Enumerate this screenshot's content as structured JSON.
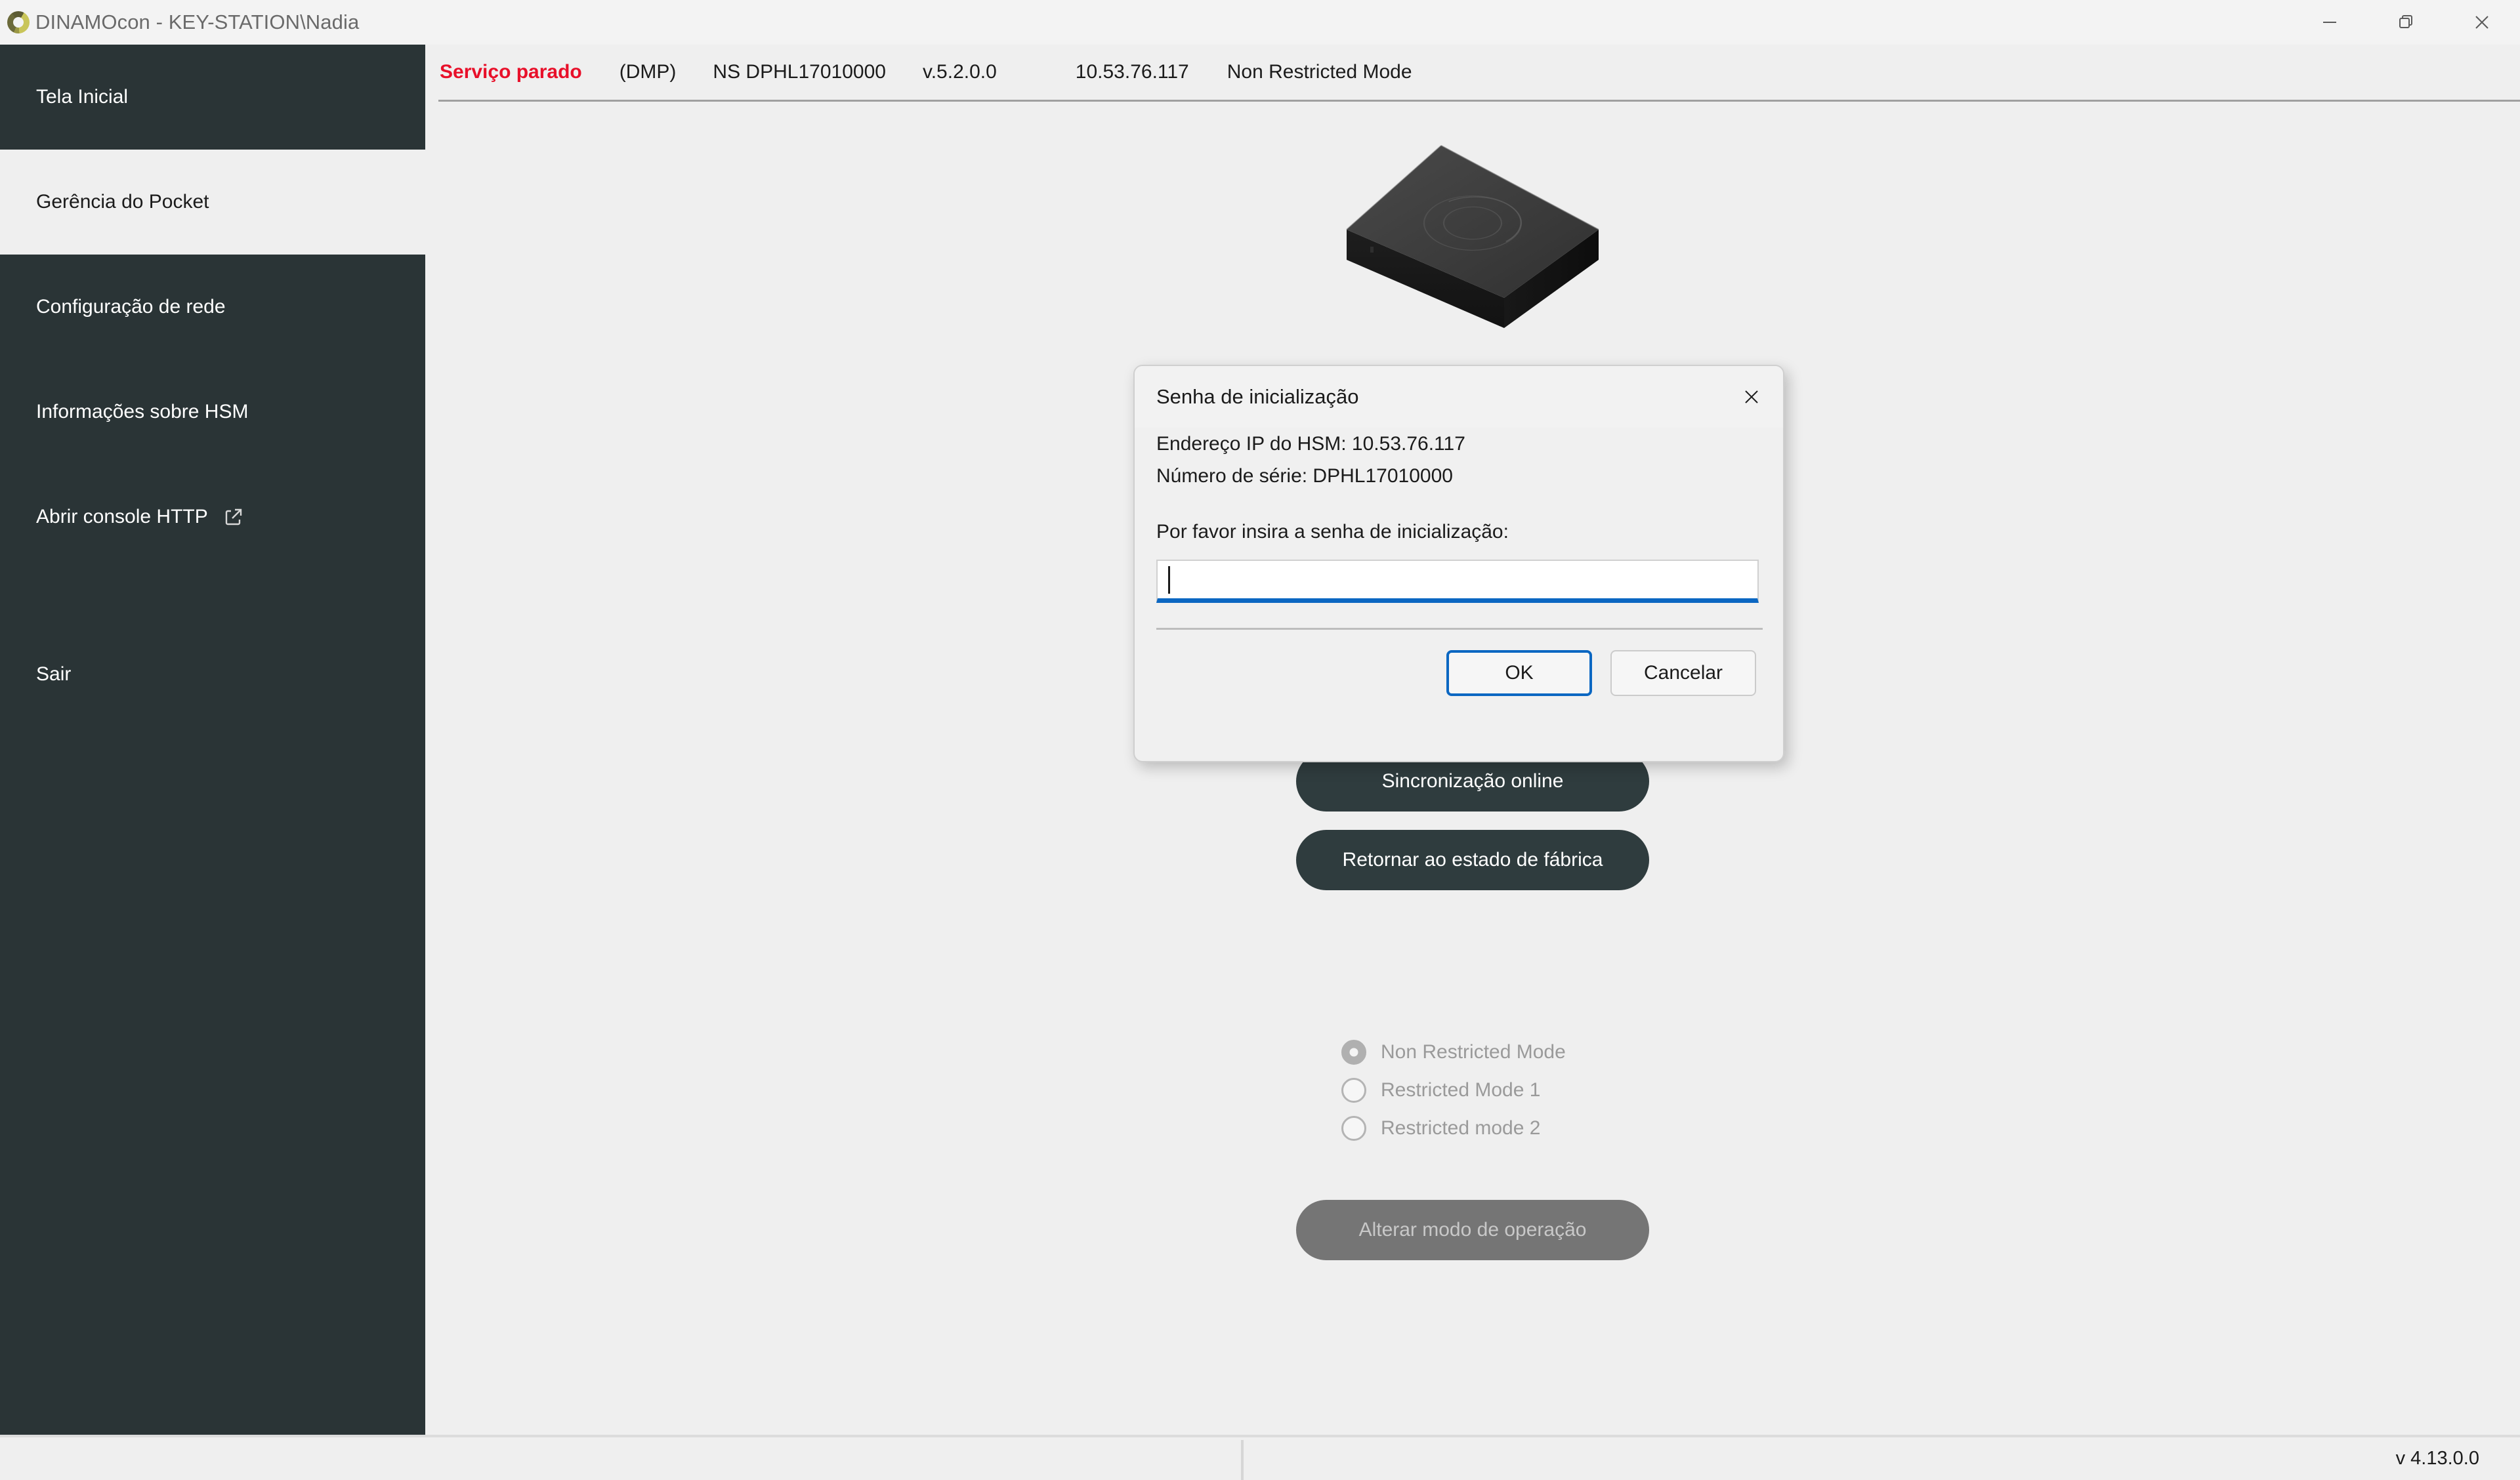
{
  "window": {
    "title": "DINAMOcon - KEY-STATION\\Nadia",
    "minimize_label": "Minimizar",
    "restore_label": "Restaurar",
    "close_label": "Fechar",
    "logo_icon": "dinamo-ring-logo-icon"
  },
  "statusbar": {
    "service_state": "Serviço parado",
    "module": "(DMP)",
    "serial": "NS DPHL17010000",
    "firmware_version": "v.5.2.0.0",
    "ip_address": "10.53.76.117",
    "operation_mode": "Non Restricted Mode",
    "service_state_color": "#e8102a"
  },
  "sidebar": {
    "background_color": "#2a3436",
    "selected_index": 1,
    "items": [
      {
        "label": "Tela Inicial",
        "selected": false,
        "icon": null
      },
      {
        "label": "Gerência do Pocket",
        "selected": true,
        "icon": null
      },
      {
        "label": "Configuração de rede",
        "selected": false,
        "icon": null
      },
      {
        "label": "Informações sobre HSM",
        "selected": false,
        "icon": null
      },
      {
        "label": "Abrir console HTTP",
        "selected": false,
        "icon": "external-link-icon"
      },
      {
        "label": "Sair",
        "selected": false,
        "icon": null
      }
    ]
  },
  "main": {
    "device_image_alt": "HSM Pocket device",
    "actions": [
      {
        "label": "Sincronização online",
        "disabled": false
      },
      {
        "label": "Retornar ao estado de fábrica",
        "disabled": false
      }
    ],
    "mode_options": [
      {
        "label": "Non Restricted Mode",
        "checked": true,
        "disabled": true
      },
      {
        "label": "Restricted Mode 1",
        "checked": false,
        "disabled": true
      },
      {
        "label": "Restricted mode 2",
        "checked": false,
        "disabled": true
      }
    ],
    "change_mode_button": {
      "label": "Alterar modo de operação",
      "disabled": true
    }
  },
  "dialog": {
    "title": "Senha de inicialização",
    "close_icon": "close-icon",
    "ip_line": "Endereço IP do HSM: 10.53.76.117",
    "serial_line": "Número de série: DPHL17010000",
    "prompt": "Por favor insira a senha de inicialização:",
    "password_value": "",
    "password_placeholder": "",
    "ok_label": "OK",
    "cancel_label": "Cancelar",
    "accent_color": "#0b67c2"
  },
  "footer": {
    "version": "v 4.13.0.0"
  }
}
